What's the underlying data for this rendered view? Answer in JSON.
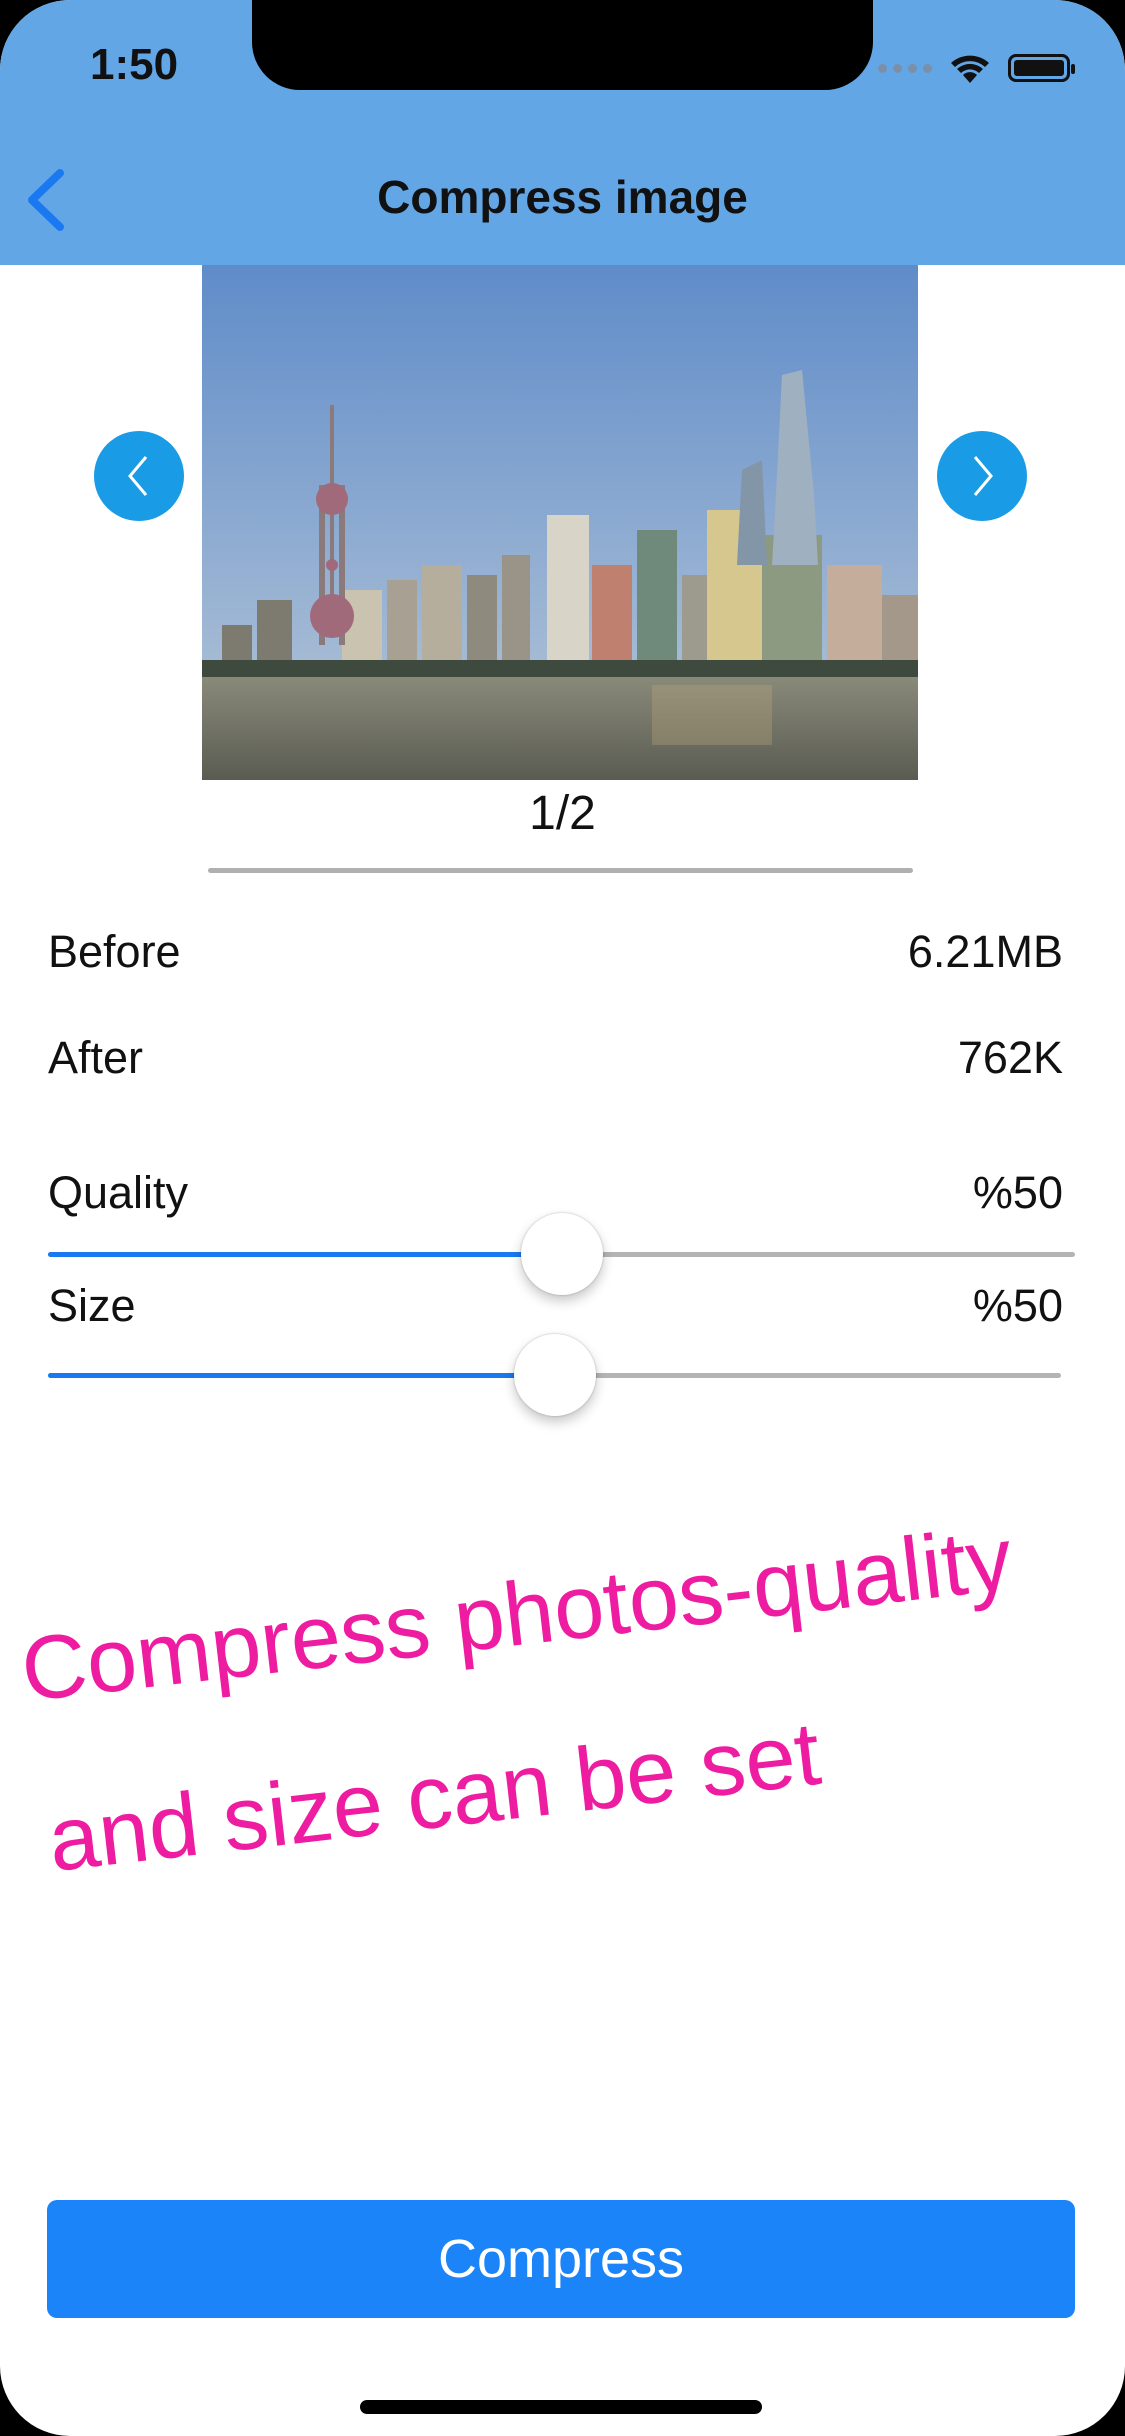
{
  "status_bar": {
    "time": "1:50"
  },
  "nav": {
    "title": "Compress image"
  },
  "carousel": {
    "counter": "1/2"
  },
  "info": {
    "before_label": "Before",
    "before_value": "6.21MB",
    "after_label": "After",
    "after_value": "762K"
  },
  "quality": {
    "label": "Quality",
    "value": "%50",
    "level": 0.5
  },
  "size": {
    "label": "Size",
    "value": "%50",
    "level": 0.5
  },
  "promo": {
    "line1": "Compress photos-quality",
    "line2": "and size can be set"
  },
  "actions": {
    "compress_label": "Compress"
  },
  "colors": {
    "header": "#62a6e6",
    "accent": "#1a84f8",
    "promo": "#ee1ca0",
    "nav_circle": "#1a9be6"
  },
  "icons": [
    "chevron-left-icon",
    "wifi-icon",
    "battery-icon",
    "arrow-left-icon",
    "arrow-right-icon"
  ]
}
